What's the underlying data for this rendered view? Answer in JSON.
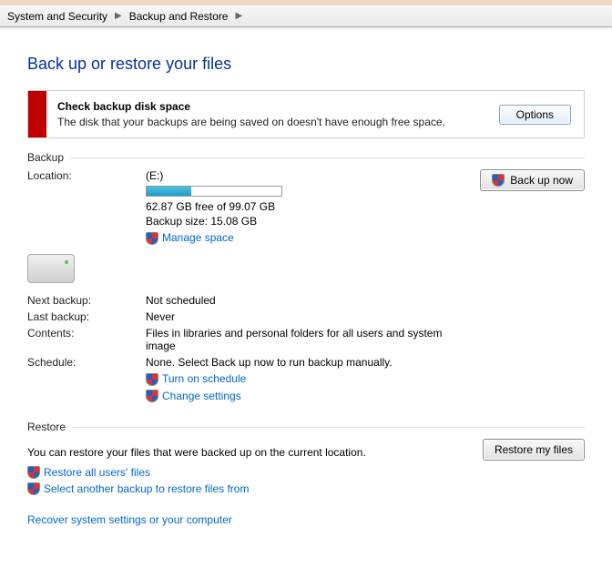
{
  "breadcrumb": {
    "crumb1": "System and Security",
    "crumb2": "Backup and Restore"
  },
  "page_title": "Back up or restore your files",
  "alert": {
    "title": "Check backup disk space",
    "message": "The disk that your backups are being saved on doesn't have enough free space.",
    "button": "Options"
  },
  "sections": {
    "backup": "Backup",
    "restore": "Restore"
  },
  "labels": {
    "location": "Location:",
    "next_backup": "Next backup:",
    "last_backup": "Last backup:",
    "contents": "Contents:",
    "schedule": "Schedule:"
  },
  "backup": {
    "drive": "(E:)",
    "free_text": "62.87 GB free of 99.07 GB",
    "size_text": "Backup size: 15.08 GB",
    "progress_percent": 33,
    "manage_space": "Manage space",
    "next_backup": "Not scheduled",
    "last_backup": "Never",
    "contents": "Files in libraries and personal folders for all users and system image",
    "schedule": "None. Select Back up now to run backup manually.",
    "turn_on_schedule": "Turn on schedule",
    "change_settings": "Change settings",
    "backup_now_btn": "Back up now"
  },
  "restore": {
    "text": "You can restore your files that were backed up on the current location.",
    "restore_btn": "Restore my files",
    "restore_all": "Restore all users' files",
    "select_another": "Select another backup to restore files from",
    "recover_system": "Recover system settings or your computer"
  }
}
